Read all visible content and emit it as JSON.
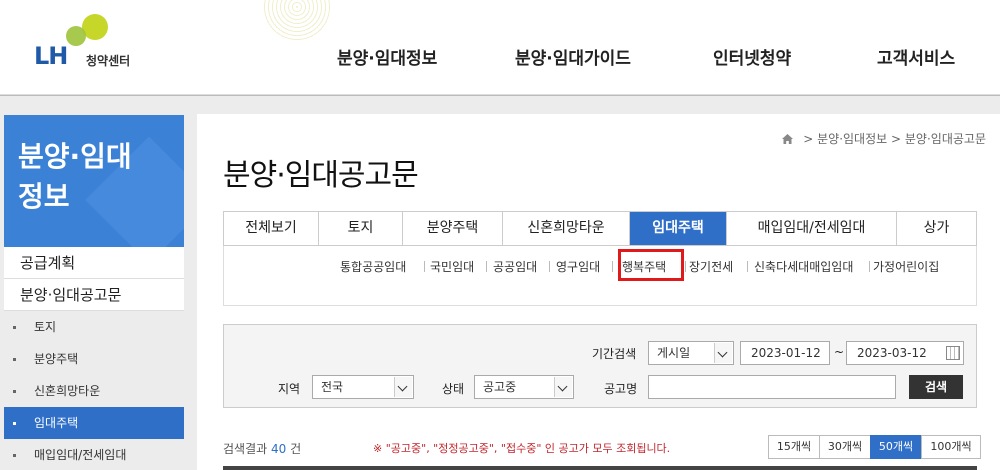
{
  "header": {
    "logo_text": "LH",
    "logo_sub": "청약센터",
    "nav": [
      "분양·임대정보",
      "분양·임대가이드",
      "인터넷청약",
      "고객서비스"
    ]
  },
  "sidebar": {
    "title_line1": "분양·임대",
    "title_line2": "정보",
    "level1": [
      "공급계획",
      "분양·임대공고문"
    ],
    "level2": [
      "토지",
      "분양주택",
      "신혼희망타운",
      "임대주택",
      "매입임대/전세임대"
    ],
    "active_item": "임대주택"
  },
  "breadcrumb": [
    "분양·임대정보",
    "분양·임대공고문"
  ],
  "page_title": "분양·임대공고문",
  "tabs": [
    "전체보기",
    "토지",
    "분양주택",
    "신혼희망타운",
    "임대주택",
    "매입임대/전세임대",
    "상가"
  ],
  "active_tab": "임대주택",
  "subtabs": [
    "통합공공임대",
    "국민임대",
    "공공임대",
    "영구임대",
    "행복주택",
    "장기전세",
    "신축다세대매입임대",
    "가정어린이집"
  ],
  "highlighted_subtab": "행복주택",
  "search": {
    "period_label": "기간검색",
    "period_type": "게시일",
    "date_from": "2023-01-12",
    "date_sep": "~",
    "date_to": "2023-03-12",
    "region_label": "지역",
    "region_value": "전국",
    "status_label": "상태",
    "status_value": "공고중",
    "title_label": "공고명",
    "title_value": "",
    "search_button": "검색"
  },
  "result": {
    "prefix": "검색결과",
    "count": "40",
    "suffix": "건",
    "notice": "※ \"공고중\", \"정정공고중\", \"접수중\" 인 공고가 모두 조회됩니다."
  },
  "page_sizes": [
    "15개씩",
    "30개씩",
    "50개씩",
    "100개씩"
  ],
  "active_page_size": "50개씩",
  "colors": {
    "brand_blue": "#2f6fc7",
    "sidebar_title_bg": "#3b82d6",
    "highlight_red": "#e01a1a",
    "notice_red": "#c0262c"
  }
}
